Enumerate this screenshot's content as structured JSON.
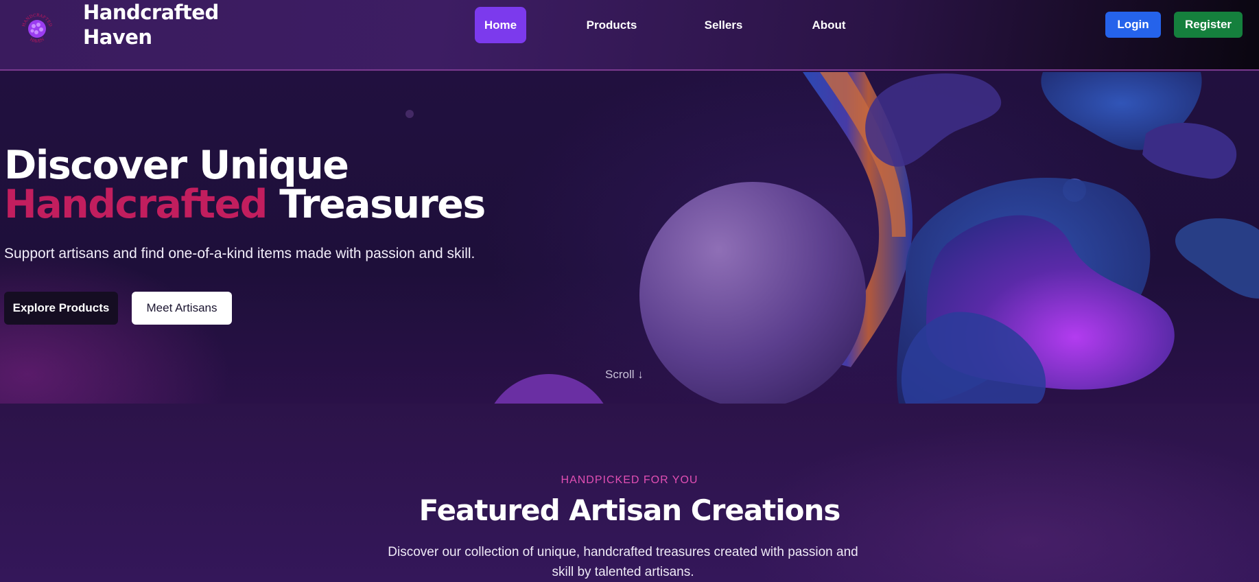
{
  "header": {
    "logo_icon": "handcrafted-haven-logo",
    "logo_ring_text": "HANDCRAFTED HAVEN",
    "brand_line1": "Handcrafted",
    "brand_line2": "Haven",
    "nav": [
      {
        "label": "Home",
        "active": true
      },
      {
        "label": "Products",
        "active": false
      },
      {
        "label": "Sellers",
        "active": false
      },
      {
        "label": "About",
        "active": false
      }
    ],
    "login_label": "Login",
    "register_label": "Register"
  },
  "hero": {
    "title_line1": "Discover Unique",
    "title_accent": "Handcrafted",
    "title_rest": " Treasures",
    "subtitle": "Support artisans and find one-of-a-kind items made with passion and skill.",
    "explore_label": "Explore Products",
    "meet_label": "Meet Artisans",
    "scroll_hint": "Scroll ↓"
  },
  "featured": {
    "eyebrow": "HANDPICKED FOR YOU",
    "title": "Featured Artisan Creations",
    "description": "Discover our collection of unique, handcrafted treasures created with passion and skill by talented artisans."
  },
  "colors": {
    "accent": "#7c3aed",
    "highlight": "#c21e5e",
    "login": "#2563eb",
    "register": "#15803d",
    "eyebrow": "#e24fb4"
  }
}
